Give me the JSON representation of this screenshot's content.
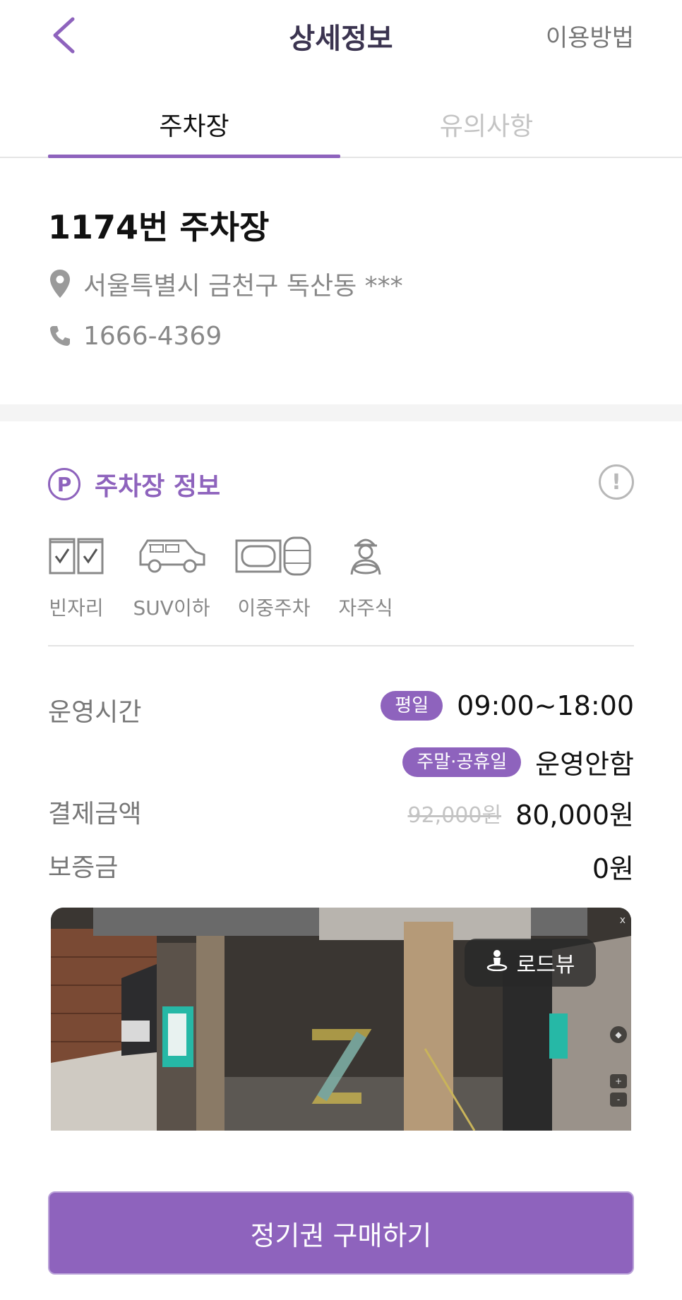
{
  "header": {
    "title": "상세정보",
    "help_link": "이용방법",
    "back_icon": "chevron-left-icon"
  },
  "tabs": [
    {
      "label": "주차장",
      "active": true
    },
    {
      "label": "유의사항",
      "active": false
    }
  ],
  "lot": {
    "name": "1174번 주차장",
    "address": "서울특별시 금천구 독산동 ***",
    "phone": "1666-4369"
  },
  "section": {
    "badge": "P",
    "title": "주차장 정보",
    "alert_symbol": "!"
  },
  "features": [
    {
      "icon": "empty-spot-icon",
      "label": "빈자리"
    },
    {
      "icon": "suv-icon",
      "label": "SUV이하"
    },
    {
      "icon": "double-parking-icon",
      "label": "이중주차"
    },
    {
      "icon": "self-parking-icon",
      "label": "자주식"
    }
  ],
  "details": {
    "hours_label": "운영시간",
    "weekday_badge": "평일",
    "weekday_hours": "09:00~18:00",
    "weekend_badge": "주말·공휴일",
    "weekend_hours": "운영안함",
    "price_label": "결제금액",
    "original_price": "92,000원",
    "price": "80,000원",
    "deposit_label": "보증금",
    "deposit": "0원"
  },
  "roadview": {
    "button_label": "로드뷰",
    "close": "x",
    "controls": [
      "+",
      "-"
    ]
  },
  "cta": {
    "label": "정기권 구매하기"
  },
  "colors": {
    "accent": "#8e63bd",
    "muted_text": "#888888",
    "divider": "#f4f4f4"
  }
}
